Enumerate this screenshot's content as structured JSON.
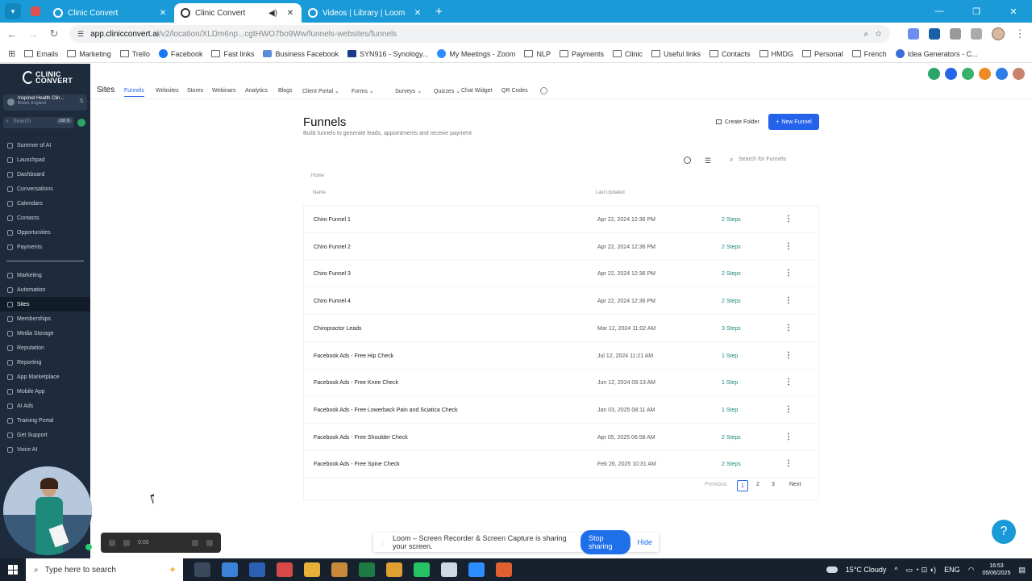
{
  "browser": {
    "tabs": [
      {
        "label": "Clinic Convert",
        "active": false
      },
      {
        "label": "Clinic Convert",
        "active": true
      },
      {
        "label": "Videos | Library | Loom",
        "active": false
      }
    ],
    "url_host": "app.clinicconvert.ai",
    "url_path": "/v2/location/XLDm6np...cgtHWO7bo9Ww/funnels-websites/funnels",
    "bookmarks": [
      "Emails",
      "Marketing",
      "Trello",
      "Facebook",
      "Fast links",
      "Business Facebook",
      "SYN916 - Synology...",
      "My Meetings - Zoom",
      "NLP",
      "Payments",
      "Clinic",
      "Useful links",
      "Contacts",
      "HMDG",
      "Personal",
      "French",
      "Idea Generators - C..."
    ]
  },
  "sidebar": {
    "logo_line1": "CLINIC",
    "logo_line2": "CONVERT",
    "account_name": "Inspired Health Clin...",
    "account_sub": "Bristol, England",
    "search_placeholder": "Search",
    "search_kbd": "ctrl K",
    "items": [
      {
        "label": "Summer of AI",
        "active": false
      },
      {
        "label": "Launchpad",
        "active": false
      },
      {
        "label": "Dashboard",
        "active": false
      },
      {
        "label": "Conversations",
        "active": false
      },
      {
        "label": "Calendars",
        "active": false
      },
      {
        "label": "Contacts",
        "active": false
      },
      {
        "label": "Opportunities",
        "active": false
      },
      {
        "label": "Payments",
        "active": false
      }
    ],
    "items2": [
      {
        "label": "Marketing",
        "active": false
      },
      {
        "label": "Automation",
        "active": false
      },
      {
        "label": "Sites",
        "active": true
      },
      {
        "label": "Memberships",
        "active": false
      },
      {
        "label": "Media Storage",
        "active": false
      },
      {
        "label": "Reputation",
        "active": false
      },
      {
        "label": "Reporting",
        "active": false
      },
      {
        "label": "App Marketplace",
        "active": false
      },
      {
        "label": "Mobile App",
        "active": false
      },
      {
        "label": "AI Ads",
        "active": false
      },
      {
        "label": "Training Portal",
        "active": false
      },
      {
        "label": "Get Support",
        "active": false
      },
      {
        "label": "Voice AI",
        "active": false
      }
    ]
  },
  "topnav": {
    "section": "Sites",
    "tabs": [
      "Funnels",
      "Websites",
      "Stores",
      "Webinars",
      "Analytics",
      "Blogs",
      "Client Portal",
      "Forms",
      "Surveys",
      "Quizzes",
      "Chat Widget",
      "QR Codes"
    ],
    "active_tab": "Funnels"
  },
  "page": {
    "title": "Funnels",
    "subtitle": "Build funnels to generate leads, appointments and receive payment",
    "create_folder": "Create Folder",
    "new_funnel": "New Funnel",
    "search_placeholder": "Search for Funnels",
    "breadcrumb": "Home",
    "col_name": "Name",
    "col_updated": "Last Updated"
  },
  "funnels": [
    {
      "name": "Chiro Funnel 1",
      "updated": "Apr 22, 2024 12:36 PM",
      "steps": "2 Steps"
    },
    {
      "name": "Chiro Funnel 2",
      "updated": "Apr 22, 2024 12:36 PM",
      "steps": "2 Steps"
    },
    {
      "name": "Chiro Funnel 3",
      "updated": "Apr 22, 2024 12:36 PM",
      "steps": "2 Steps"
    },
    {
      "name": "Chiro Funnel 4",
      "updated": "Apr 22, 2024 12:36 PM",
      "steps": "2 Steps"
    },
    {
      "name": "Chiropractor Leads",
      "updated": "Mar 12, 2024 11:02 AM",
      "steps": "3 Steps"
    },
    {
      "name": "Facebook Ads - Free Hip Check",
      "updated": "Jul 12, 2024 11:21 AM",
      "steps": "1 Step"
    },
    {
      "name": "Facebook Ads - Free Knee Check",
      "updated": "Jun 12, 2024 08:13 AM",
      "steps": "1 Step"
    },
    {
      "name": "Facebook Ads - Free Lowerback Pain and Sciatica Check",
      "updated": "Jan 03, 2025 08:11 AM",
      "steps": "1 Step"
    },
    {
      "name": "Facebook Ads - Free Shoulder Check",
      "updated": "Apr 05, 2025 06:58 AM",
      "steps": "2 Steps"
    },
    {
      "name": "Facebook Ads - Free Spine Check",
      "updated": "Feb 26, 2025 10:31 AM",
      "steps": "2 Steps"
    }
  ],
  "pagination": {
    "previous": "Previous",
    "pages": [
      "1",
      "2",
      "3"
    ],
    "next": "Next",
    "current": "1"
  },
  "loom": {
    "message": "Loom – Screen Recorder & Screen Capture is sharing your screen.",
    "stop": "Stop sharing",
    "hide": "Hide",
    "timer": "0:00"
  },
  "help_icon": "?",
  "taskbar": {
    "search_placeholder": "Type here to search",
    "weather": "15°C  Cloudy",
    "lang": "ENG",
    "time": "16:53",
    "date": "05/06/2025"
  },
  "colors": {
    "chrome_blue": "#1a9bd7",
    "sidebar_bg": "#1d2b3c",
    "primary": "#2563eb",
    "steps_green": "#1a8a7a"
  }
}
